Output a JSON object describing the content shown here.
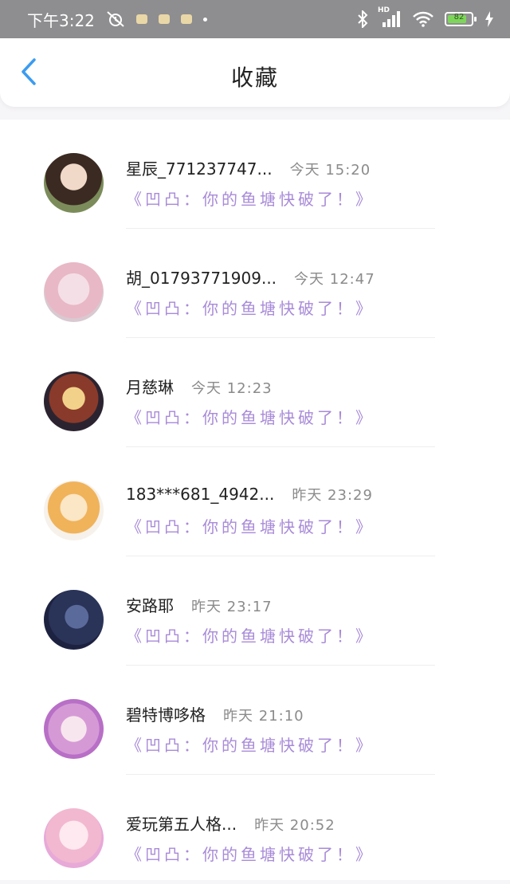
{
  "status_bar": {
    "time": "下午3:22",
    "network": "HD",
    "battery": "82",
    "icons": [
      "alarm-off-icon",
      "bluetooth-icon",
      "signal-icon",
      "wifi-icon",
      "battery-icon",
      "charging-icon"
    ]
  },
  "header": {
    "back_icon": "chevron-left-icon",
    "title": "收藏"
  },
  "colors": {
    "preview_text": "#a88bd8",
    "status_bar_bg": "#8e8e90",
    "back_icon": "#3b9cf0"
  },
  "items": [
    {
      "name": "星辰_771237747...",
      "time": "今天 15:20",
      "preview": "《凹凸：你的鱼塘快破了！》"
    },
    {
      "name": "胡_01793771909...",
      "time": "今天 12:47",
      "preview": "《凹凸：你的鱼塘快破了！》"
    },
    {
      "name": "月慈琳",
      "time": "今天 12:23",
      "preview": "《凹凸：你的鱼塘快破了！》"
    },
    {
      "name": "183***681_4942...",
      "time": "昨天 23:29",
      "preview": "《凹凸：你的鱼塘快破了！》"
    },
    {
      "name": "安路耶",
      "time": "昨天 23:17",
      "preview": "《凹凸：你的鱼塘快破了！》"
    },
    {
      "name": "碧特博哆格",
      "time": "昨天 21:10",
      "preview": "《凹凸：你的鱼塘快破了！》"
    },
    {
      "name": "爱玩第五人格...",
      "time": "昨天 20:52",
      "preview": "《凹凸：你的鱼塘快破了！》"
    }
  ]
}
